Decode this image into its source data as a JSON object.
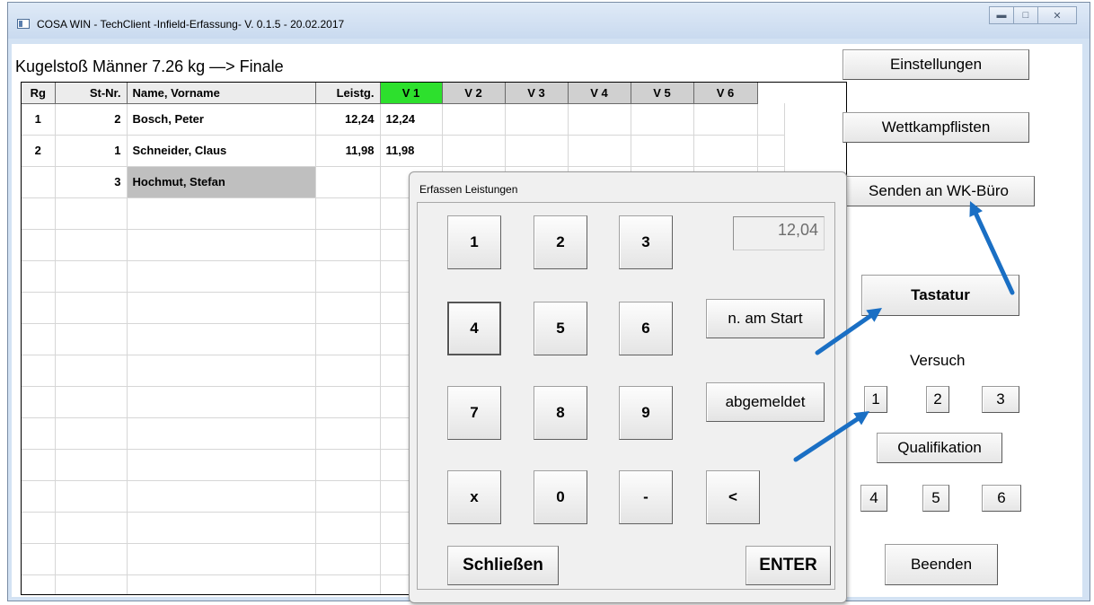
{
  "window": {
    "title": "COSA WIN - TechClient  -Infield-Erfassung-  V. 0.1.5  -  20.02.2017"
  },
  "heading": "Kugelstoß Männer 7.26 kg  —>  Finale",
  "table": {
    "headers": [
      "Rg",
      "St-Nr.",
      "Name, Vorname",
      "Leistg.",
      "V  1",
      "V  2",
      "V  3",
      "V  4",
      "V  5",
      "V  6"
    ],
    "active_attempt_header_color": "#2de02d",
    "selected_cell_color": "#bfbfbf",
    "rows": [
      [
        "1",
        "2",
        "Bosch, Peter",
        "12,24",
        "12,24",
        "",
        "",
        "",
        "",
        ""
      ],
      [
        "2",
        "1",
        "Schneider, Claus",
        "11,98",
        "11,98",
        "",
        "",
        "",
        "",
        ""
      ],
      [
        "",
        "3",
        "Hochmut, Stefan",
        "",
        "",
        "",
        "",
        "",
        "",
        ""
      ]
    ]
  },
  "right_panel": {
    "settings": "Einstellungen",
    "lists": "Wettkampflisten",
    "send": "Senden an WK-Büro",
    "keyboard": "Tastatur",
    "attempt_label": "Versuch",
    "attempts_top": [
      "1",
      "2",
      "3"
    ],
    "qualification": "Qualifikation",
    "attempts_bottom": [
      "4",
      "5",
      "6"
    ],
    "exit": "Beenden"
  },
  "dialog": {
    "title": "Erfassen Leistungen",
    "display_value": "12,04",
    "keys": [
      "1",
      "2",
      "3",
      "4",
      "5",
      "6",
      "7",
      "8",
      "9",
      "x",
      "0",
      "-",
      "<"
    ],
    "not_started": "n. am Start",
    "withdrawn": "abgemeldet",
    "close": "Schließen",
    "enter": "ENTER"
  },
  "annotation_color": "#1a6fc4"
}
